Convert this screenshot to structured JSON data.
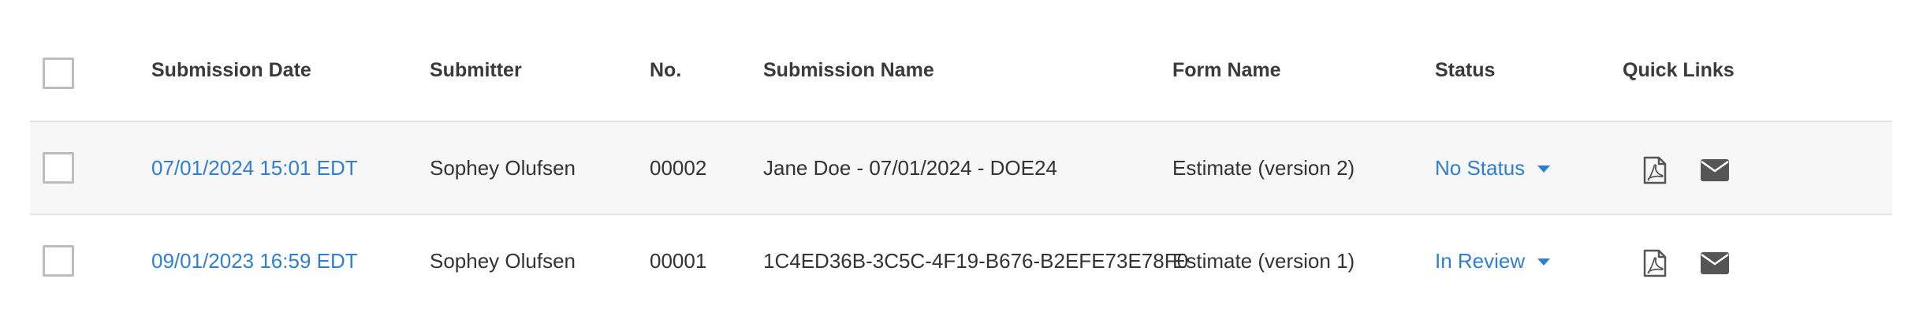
{
  "table": {
    "headers": {
      "submission_date": "Submission Date",
      "submitter": "Submitter",
      "number": "No.",
      "submission_name": "Submission Name",
      "form_name": "Form Name",
      "status": "Status",
      "quick_links": "Quick Links"
    },
    "rows": [
      {
        "submission_date": "07/01/2024 15:01 EDT",
        "submitter": "Sophey Olufsen",
        "number": "00002",
        "submission_name": "Jane Doe - 07/01/2024 - DOE24",
        "form_name": "Estimate (version 2)",
        "status": "No Status",
        "quick_links": [
          "pdf-icon",
          "envelope-icon"
        ]
      },
      {
        "submission_date": "09/01/2023 16:59 EDT",
        "submitter": "Sophey Olufsen",
        "number": "00001",
        "submission_name": "1C4ED36B-3C5C-4F19-B676-B2EFE73E78F0",
        "form_name": "Estimate (version 1)",
        "status": "In Review",
        "quick_links": [
          "pdf-icon",
          "envelope-icon"
        ]
      }
    ]
  },
  "colors": {
    "link": "#2f7fd1",
    "text": "#333333",
    "row_shade": "#f7f7f7",
    "divider": "#e1e1e1",
    "checkbox_border": "#bdbdbd",
    "icon": "#555555"
  }
}
